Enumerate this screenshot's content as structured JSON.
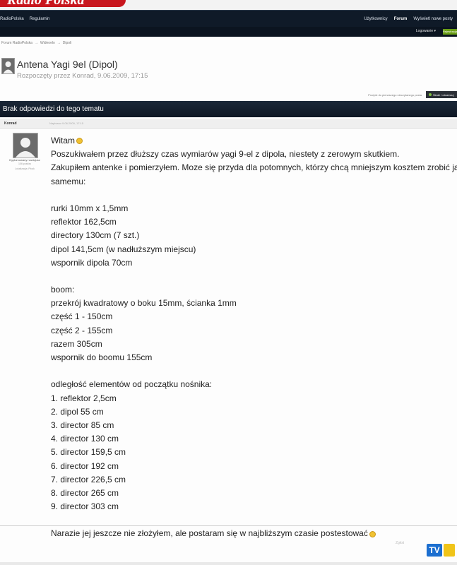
{
  "banner": {
    "logo_text": "Radio Polska"
  },
  "nav": {
    "left": [
      "RadioPolska",
      "Regulamin"
    ],
    "right": [
      "Użytkownicy",
      "Forum",
      "Wyświetl nowe posty"
    ],
    "active": "Forum"
  },
  "subbar": {
    "login": "Logowanie ▾",
    "green": "Rejestracja"
  },
  "breadcrumb": [
    "Forum RadioPolska",
    "Wideoelo",
    "Dipoli"
  ],
  "thread": {
    "title": "Antena Yagi 9el (Dipol)",
    "meta": "Rozpoczęty przez Konrad, 9.06.2009, 17:15"
  },
  "actions": {
    "link": "Przejdź do pierwszego nieczytanego posta",
    "watch": "Śledź / obserwuj"
  },
  "noreply": "Brak odpowiedzi do tego tematu",
  "post": {
    "author": "Konrad",
    "date": "Napisano 9.06.2009, 17:15",
    "user_name": "Dyplomowany nowicjusz",
    "user_sub": "106 postów",
    "user_sub2": "Lokalizacja: Płock",
    "lines": [
      "Witam",
      "Poszukiwałem przez dłuższy czas wymiarów yagi 9-el z dipola, niestety z zerowym skutkiem.",
      "Zakupiłem antenke i pomierzyłem. Moze się przyda dla potomnych, którzy chcą mniejszym kosztem zrobić ją",
      "samemu:",
      "",
      "rurki 10mm x 1,5mm",
      "reflektor 162,5cm",
      "directory 130cm (7 szt.)",
      "dipol 141,5cm (w nadłuższym miejscu)",
      "wspornik dipola 70cm",
      "",
      "boom:",
      "przekrój kwadratowy o boku 15mm, ścianka 1mm",
      "część 1 - 150cm",
      "część 2 - 155cm",
      "razem 305cm",
      "wspornik do boomu 155cm",
      "",
      "odległość elementów od początku nośnika:",
      "1. reflektor 2,5cm",
      "2. dipol 55 cm",
      "3. director 85 cm",
      "4. director 130 cm",
      "5. director 159,5 cm",
      "6. director 192 cm",
      "7. director 226,5 cm",
      "8. director 265 cm",
      "9. director 303 cm",
      "",
      "Narazie jej jeszcze nie złożyłem, ale postaram się w najbliższym czasie postestować"
    ]
  },
  "watermark": "Zgłoś",
  "tv_logo": "TV"
}
